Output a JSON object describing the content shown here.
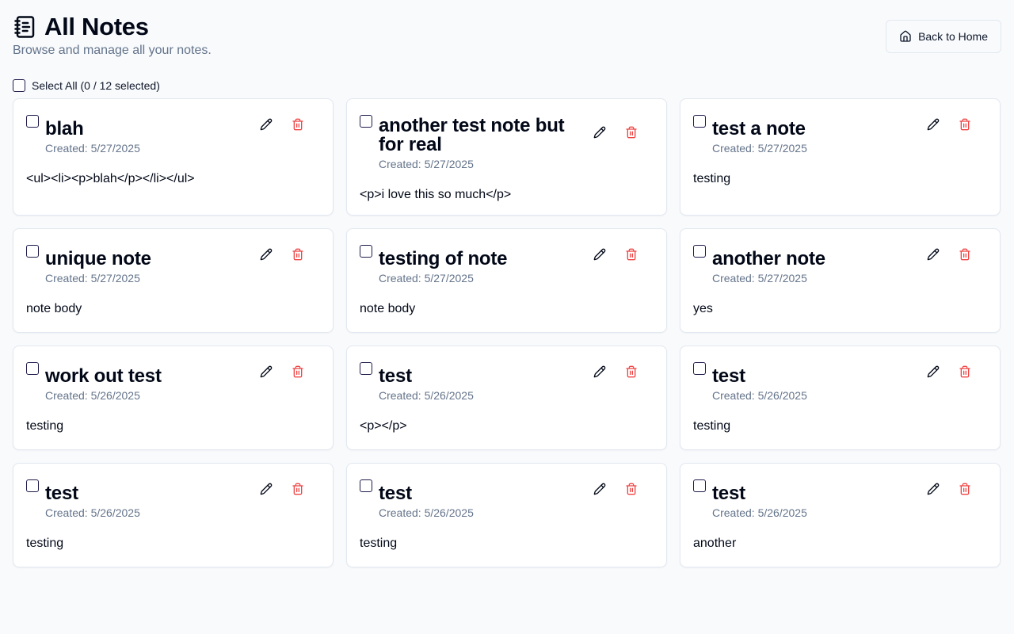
{
  "header": {
    "title": "All Notes",
    "subtitle": "Browse and manage all your notes.",
    "back_label": "Back to Home"
  },
  "select_all": {
    "label": "Select All (0 / 12 selected)"
  },
  "notes": [
    {
      "title": "blah",
      "date": "Created: 5/27/2025",
      "body": "<ul><li><p>blah</p></li></ul>"
    },
    {
      "title": "another test note but for real",
      "date": "Created: 5/27/2025",
      "body": "<p>i love this so much</p>"
    },
    {
      "title": "test a note",
      "date": "Created: 5/27/2025",
      "body": "testing"
    },
    {
      "title": "unique note",
      "date": "Created: 5/27/2025",
      "body": "note body"
    },
    {
      "title": "testing of note",
      "date": "Created: 5/27/2025",
      "body": "note body"
    },
    {
      "title": "another note",
      "date": "Created: 5/27/2025",
      "body": "yes"
    },
    {
      "title": "work out test",
      "date": "Created: 5/26/2025",
      "body": "testing"
    },
    {
      "title": "test",
      "date": "Created: 5/26/2025",
      "body": "<p></p>"
    },
    {
      "title": "test",
      "date": "Created: 5/26/2025",
      "body": "testing"
    },
    {
      "title": "test",
      "date": "Created: 5/26/2025",
      "body": "testing"
    },
    {
      "title": "test",
      "date": "Created: 5/26/2025",
      "body": "testing"
    },
    {
      "title": "test",
      "date": "Created: 5/26/2025",
      "body": "another"
    }
  ],
  "colors": {
    "delete": "#ef4444",
    "muted": "#64748b",
    "border": "#e2e8f0",
    "checkbox": "#1e1b4b"
  },
  "icons": {
    "title": "notebook-icon",
    "back": "home-icon",
    "edit": "pencil-icon",
    "delete": "trash-icon"
  }
}
